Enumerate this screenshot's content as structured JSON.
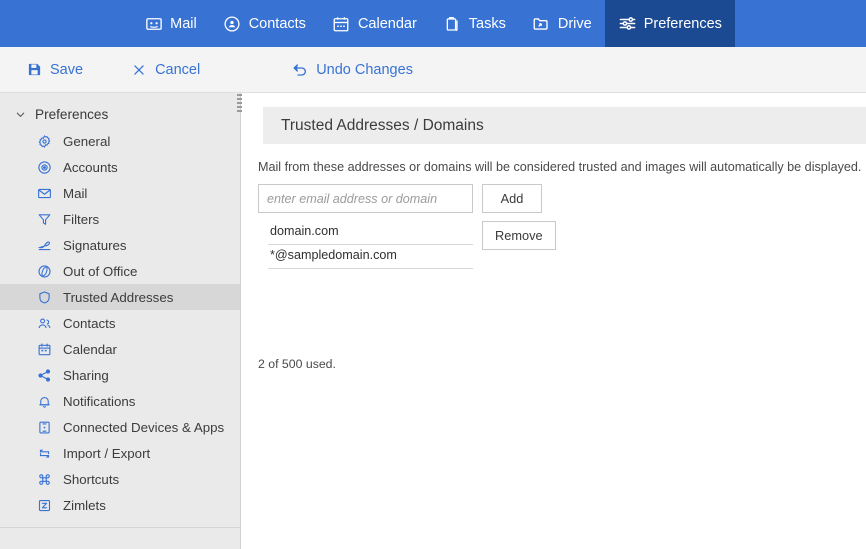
{
  "topnav": {
    "tabs": [
      {
        "label": "Mail",
        "icon": "mail-icon",
        "active": false
      },
      {
        "label": "Contacts",
        "icon": "contacts-icon",
        "active": false
      },
      {
        "label": "Calendar",
        "icon": "calendar-icon",
        "active": false
      },
      {
        "label": "Tasks",
        "icon": "tasks-icon",
        "active": false
      },
      {
        "label": "Drive",
        "icon": "drive-icon",
        "active": false
      },
      {
        "label": "Preferences",
        "icon": "preferences-icon",
        "active": true
      }
    ],
    "background_color": "#3873d4",
    "active_background_color": "#1b4a93"
  },
  "toolbar": {
    "save_label": "Save",
    "cancel_label": "Cancel",
    "undo_label": "Undo Changes",
    "link_color": "#3873d4"
  },
  "sidebar": {
    "root_label": "Preferences",
    "selected_background_color": "#d7d7d7",
    "items": [
      {
        "label": "General",
        "icon": "gear-icon"
      },
      {
        "label": "Accounts",
        "icon": "account-circle-icon"
      },
      {
        "label": "Mail",
        "icon": "envelope-icon"
      },
      {
        "label": "Filters",
        "icon": "funnel-icon"
      },
      {
        "label": "Signatures",
        "icon": "signature-pen-icon"
      },
      {
        "label": "Out of Office",
        "icon": "out-of-office-icon"
      },
      {
        "label": "Trusted Addresses",
        "icon": "shield-icon"
      },
      {
        "label": "Contacts",
        "icon": "people-icon"
      },
      {
        "label": "Calendar",
        "icon": "calendar-icon"
      },
      {
        "label": "Sharing",
        "icon": "share-icon"
      },
      {
        "label": "Notifications",
        "icon": "bell-icon"
      },
      {
        "label": "Connected Devices & Apps",
        "icon": "device-icon"
      },
      {
        "label": "Import / Export",
        "icon": "import-export-icon"
      },
      {
        "label": "Shortcuts",
        "icon": "command-icon"
      },
      {
        "label": "Zimlets",
        "icon": "zimlet-z-icon"
      }
    ],
    "selected_index": 6
  },
  "main": {
    "panel_title": "Trusted Addresses / Domains",
    "description": "Mail from these addresses or domains will be considered trusted and images will automatically be displayed.",
    "input_value": "",
    "input_placeholder": "enter email address or domain",
    "add_label": "Add",
    "remove_label": "Remove",
    "addresses": [
      "domain.com",
      "*@sampledomain.com"
    ],
    "usage_text": "2 of 500 used."
  }
}
